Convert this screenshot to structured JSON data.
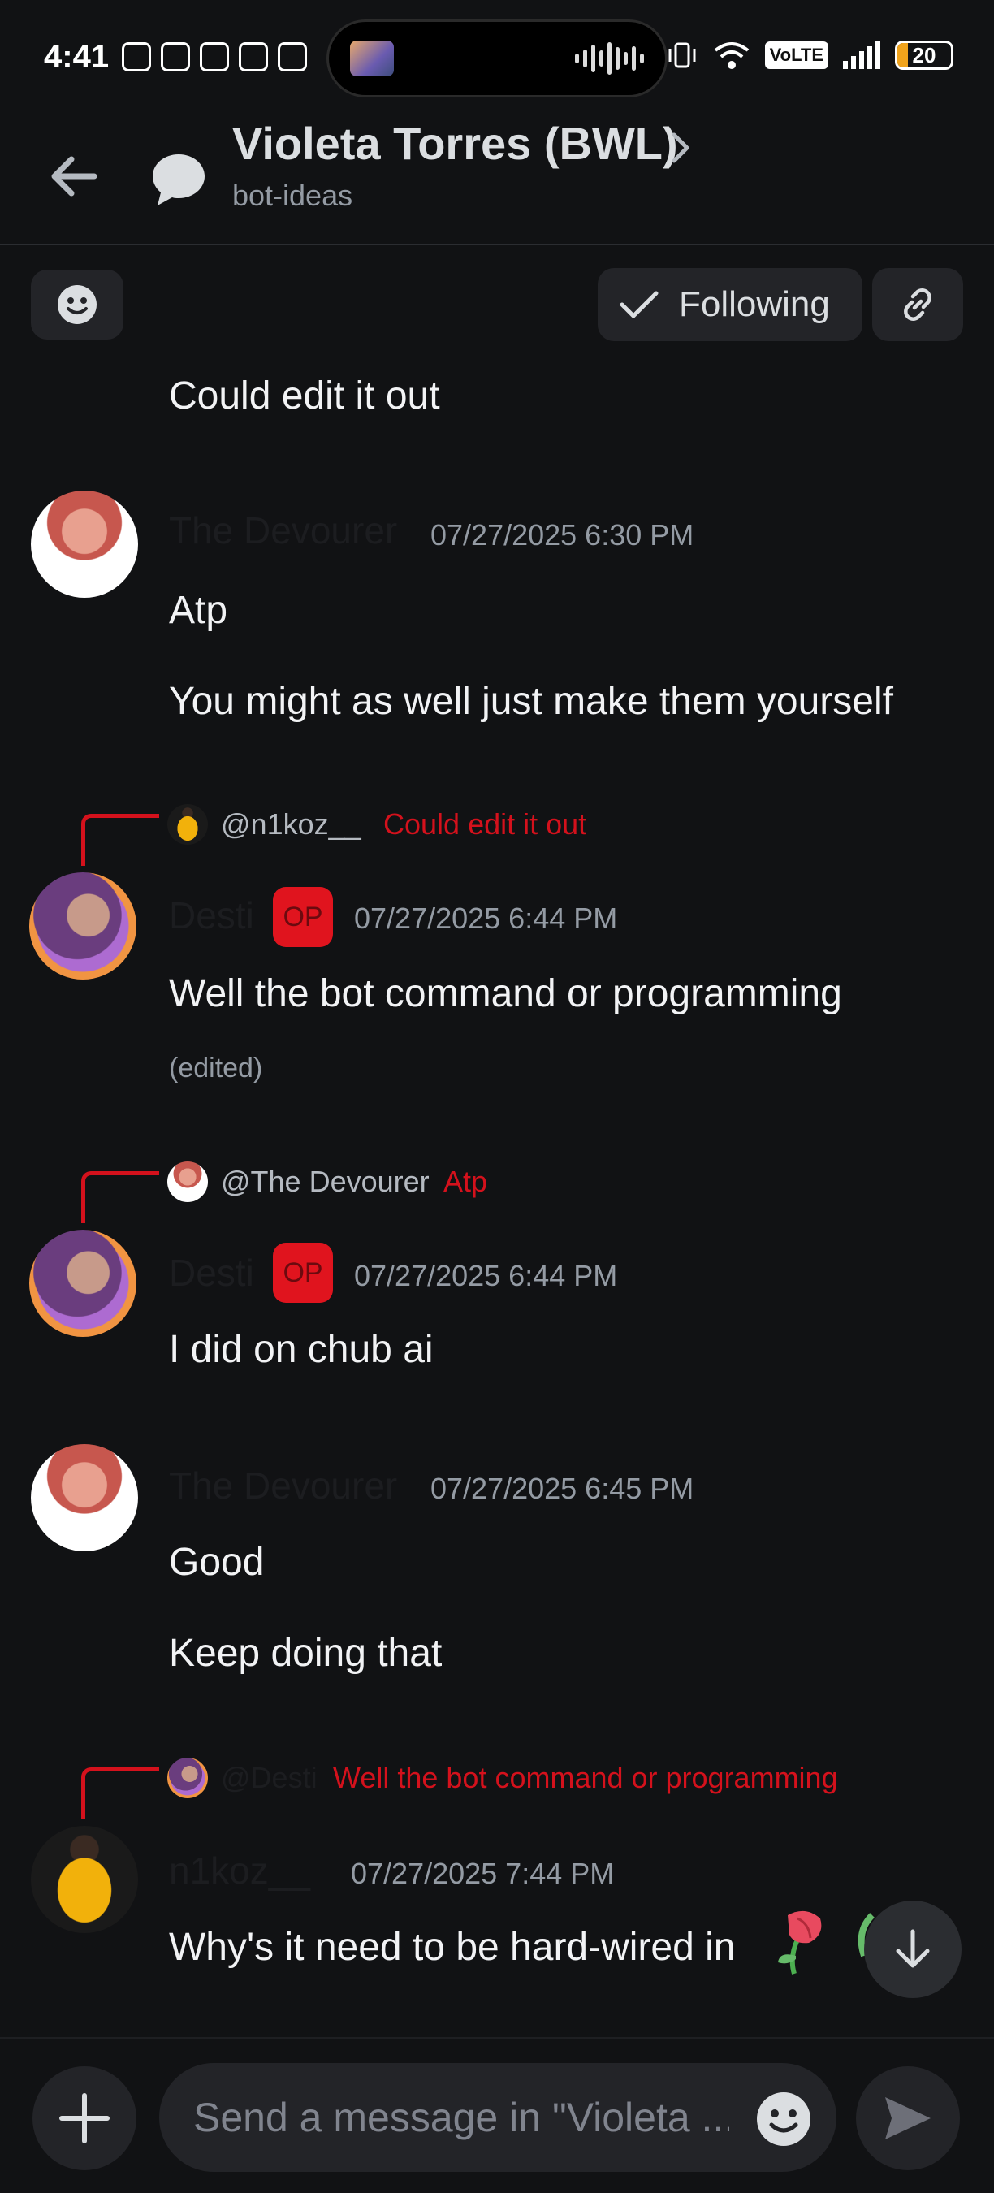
{
  "status_bar": {
    "time": "4:41",
    "network_label": "VoLTE",
    "battery_level": "20"
  },
  "header": {
    "title": "Violeta Torres (BWL)",
    "subtitle": "bot-ideas"
  },
  "toolbar": {
    "following_label": "Following"
  },
  "messages": [
    {
      "text": "Could edit it out"
    },
    {
      "author": "The Devourer",
      "timestamp": "07/27/2025 6:30 PM",
      "lines": [
        "Atp",
        "You might as well just make them yourself"
      ]
    },
    {
      "reply_to": {
        "name": "@n1koz__",
        "content": "Could edit it out"
      },
      "author": "Desti",
      "badge": "OP",
      "timestamp": "07/27/2025 6:44 PM",
      "lines": [
        "Well the bot command or programming"
      ],
      "edited": "(edited)"
    },
    {
      "reply_to": {
        "name": "@The Devourer",
        "content": "Atp"
      },
      "author": "Desti",
      "badge": "OP",
      "timestamp": "07/27/2025 6:44 PM",
      "lines": [
        "I did on chub ai"
      ]
    },
    {
      "author": "The Devourer",
      "timestamp": "07/27/2025 6:45 PM",
      "lines": [
        "Good",
        "Keep doing that"
      ]
    },
    {
      "reply_to": {
        "name": "@Desti",
        "content": "Well the bot command or programming"
      },
      "author": "n1koz__",
      "timestamp": "07/27/2025 7:44 PM",
      "lines": [
        "Why's it need to be hard-wired in"
      ]
    }
  ],
  "composer": {
    "placeholder": "Send a message in \"Violeta ..."
  },
  "colors": {
    "background": "#111214",
    "reply_accent": "#d4111c",
    "op_badge": "#e0141e"
  },
  "icons": {
    "back": "arrow-left-icon",
    "channel": "thread-bubble-icon",
    "emoji": "smiley-icon",
    "following": "checkmark-icon",
    "link": "link-icon",
    "scroll": "arrow-down-icon",
    "add": "plus-icon",
    "send": "send-icon"
  }
}
